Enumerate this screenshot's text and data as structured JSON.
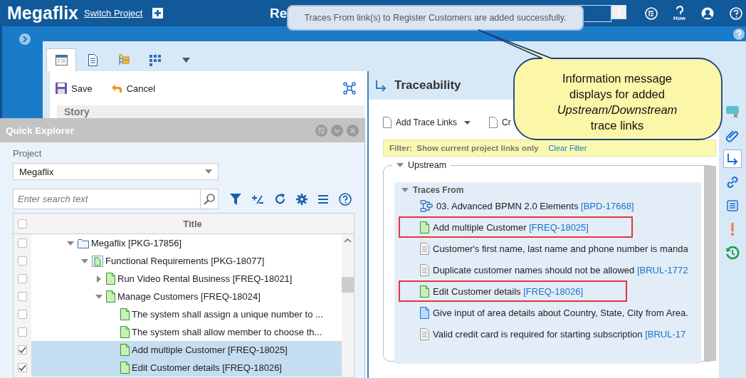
{
  "header": {
    "logo": "Megaflix",
    "switch_link": "Switch Project",
    "title": "Re",
    "how_label": "How"
  },
  "toast": {
    "text": "Traces From link(s) to Register Customers are added successfully."
  },
  "callout": {
    "text": "Information message displays for added *Upstream/Downstream* trace links"
  },
  "editor": {
    "tabs": [
      {
        "kind": "form",
        "selected": true
      },
      {
        "kind": "document",
        "selected": false
      },
      {
        "kind": "tree",
        "selected": false
      },
      {
        "kind": "grid",
        "selected": false
      }
    ],
    "toolbar": [
      {
        "kind": "save",
        "label": "Save"
      },
      {
        "kind": "cancel",
        "label": "Cancel"
      }
    ],
    "section": "Story"
  },
  "traceability": {
    "title": "Traceability",
    "toolbar": [
      {
        "label": "Add Trace Links",
        "dropdown": true
      },
      {
        "label": "Cr",
        "dropdown": false
      }
    ],
    "filter": {
      "label": "Filter:",
      "value": "Show current project links only",
      "clear": "Clear Filter"
    },
    "section": {
      "title": "Upstream",
      "expanded": true,
      "groups": [
        {
          "title": "Traces From",
          "expanded": true,
          "items": [
            {
              "kind": "process",
              "title": "03. Advanced BPMN 2.0 Elements",
              "id": "[BPD-17668]",
              "highlighted": false
            },
            {
              "kind": "requirement",
              "title": "Add multiple Customer",
              "id": "[FREQ-18025]",
              "highlighted": true
            },
            {
              "kind": "rule",
              "title": "Customer's first name, last name and phone number is manda",
              "highlighted": false
            },
            {
              "kind": "rule",
              "title": "Duplicate customer names should not be allowed",
              "id": "[BRUL-1772",
              "highlighted": false
            },
            {
              "kind": "requirement",
              "title": "Edit Customer details",
              "id": "[FREQ-18026]",
              "highlighted": true
            },
            {
              "kind": "usecase",
              "title": "Give input of area details about Country, State, City from Area.",
              "highlighted": false
            },
            {
              "kind": "rule",
              "title": "Valid credit card is required for starting subscription",
              "id": "[BRUL-17",
              "highlighted": false
            }
          ]
        }
      ]
    }
  },
  "rail": [
    {
      "kind": "comment",
      "selected": false
    },
    {
      "kind": "attachment",
      "selected": false
    },
    {
      "kind": "trace",
      "selected": true
    },
    {
      "kind": "link",
      "selected": false
    },
    {
      "kind": "list",
      "selected": false
    },
    {
      "kind": "alert",
      "selected": false
    },
    {
      "kind": "history",
      "selected": false
    }
  ],
  "quick_explorer": {
    "title": "Quick Explorer",
    "project_label": "Project",
    "project": "Megaflix",
    "search_placeholder": "Enter search text",
    "column": "Title",
    "all_checked": false,
    "rows": [
      {
        "kind": "package",
        "title": "Megaflix [PKG-17856]",
        "expanded": true,
        "checked": false,
        "selected": false,
        "children": [
          {
            "kind": "req-package",
            "title": "Functional Requirements [PKG-18077]",
            "expanded": true,
            "checked": false,
            "selected": false,
            "children": [
              {
                "kind": "requirement",
                "title": "Run Video Rental Business [FREQ-18021]",
                "expanded": false,
                "checked": false,
                "selected": false
              },
              {
                "kind": "requirement",
                "title": "Manage Customers [FREQ-18024]",
                "expanded": true,
                "checked": false,
                "selected": false,
                "children": [
                  {
                    "kind": "requirement",
                    "title": "The system shall assign a unique number to ...",
                    "checked": false,
                    "selected": false
                  },
                  {
                    "kind": "requirement",
                    "title": "The system shall allow member to choose th...",
                    "checked": false,
                    "selected": false
                  },
                  {
                    "kind": "requirement",
                    "title": "Add multiple Customer [FREQ-18025]",
                    "checked": true,
                    "selected": true
                  },
                  {
                    "kind": "requirement",
                    "title": "Edit Customer details [FREQ-18026]",
                    "checked": true,
                    "selected": true
                  }
                ]
              }
            ]
          }
        ]
      }
    ]
  }
}
